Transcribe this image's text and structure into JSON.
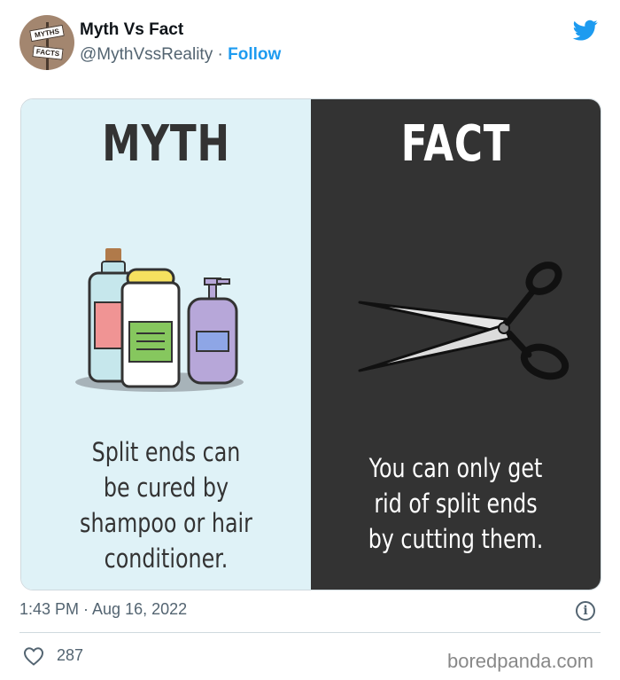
{
  "header": {
    "display_name": "Myth Vs Fact",
    "handle": "@MythVssReality",
    "separator": "·",
    "follow_label": "Follow",
    "avatar_sign_top": "MYTHS",
    "avatar_sign_bottom": "FACTS"
  },
  "media": {
    "myth": {
      "title": "MYTH",
      "lines": [
        "Split ends can",
        "be cured by",
        "shampoo or hair",
        "conditioner."
      ]
    },
    "fact": {
      "title": "FACT",
      "lines": [
        "You can only get",
        "rid of split ends",
        "by cutting them."
      ]
    }
  },
  "footer": {
    "timestamp": "1:43 PM · Aug 16, 2022",
    "likes": "287",
    "source": "boredpanda.com"
  },
  "icons": {
    "brand": "twitter-bird-icon",
    "info": "info-icon",
    "like": "heart-icon"
  },
  "colors": {
    "twitter_blue": "#1d9bf0",
    "myth_bg": "#dff2f7",
    "fact_bg": "#333333"
  }
}
